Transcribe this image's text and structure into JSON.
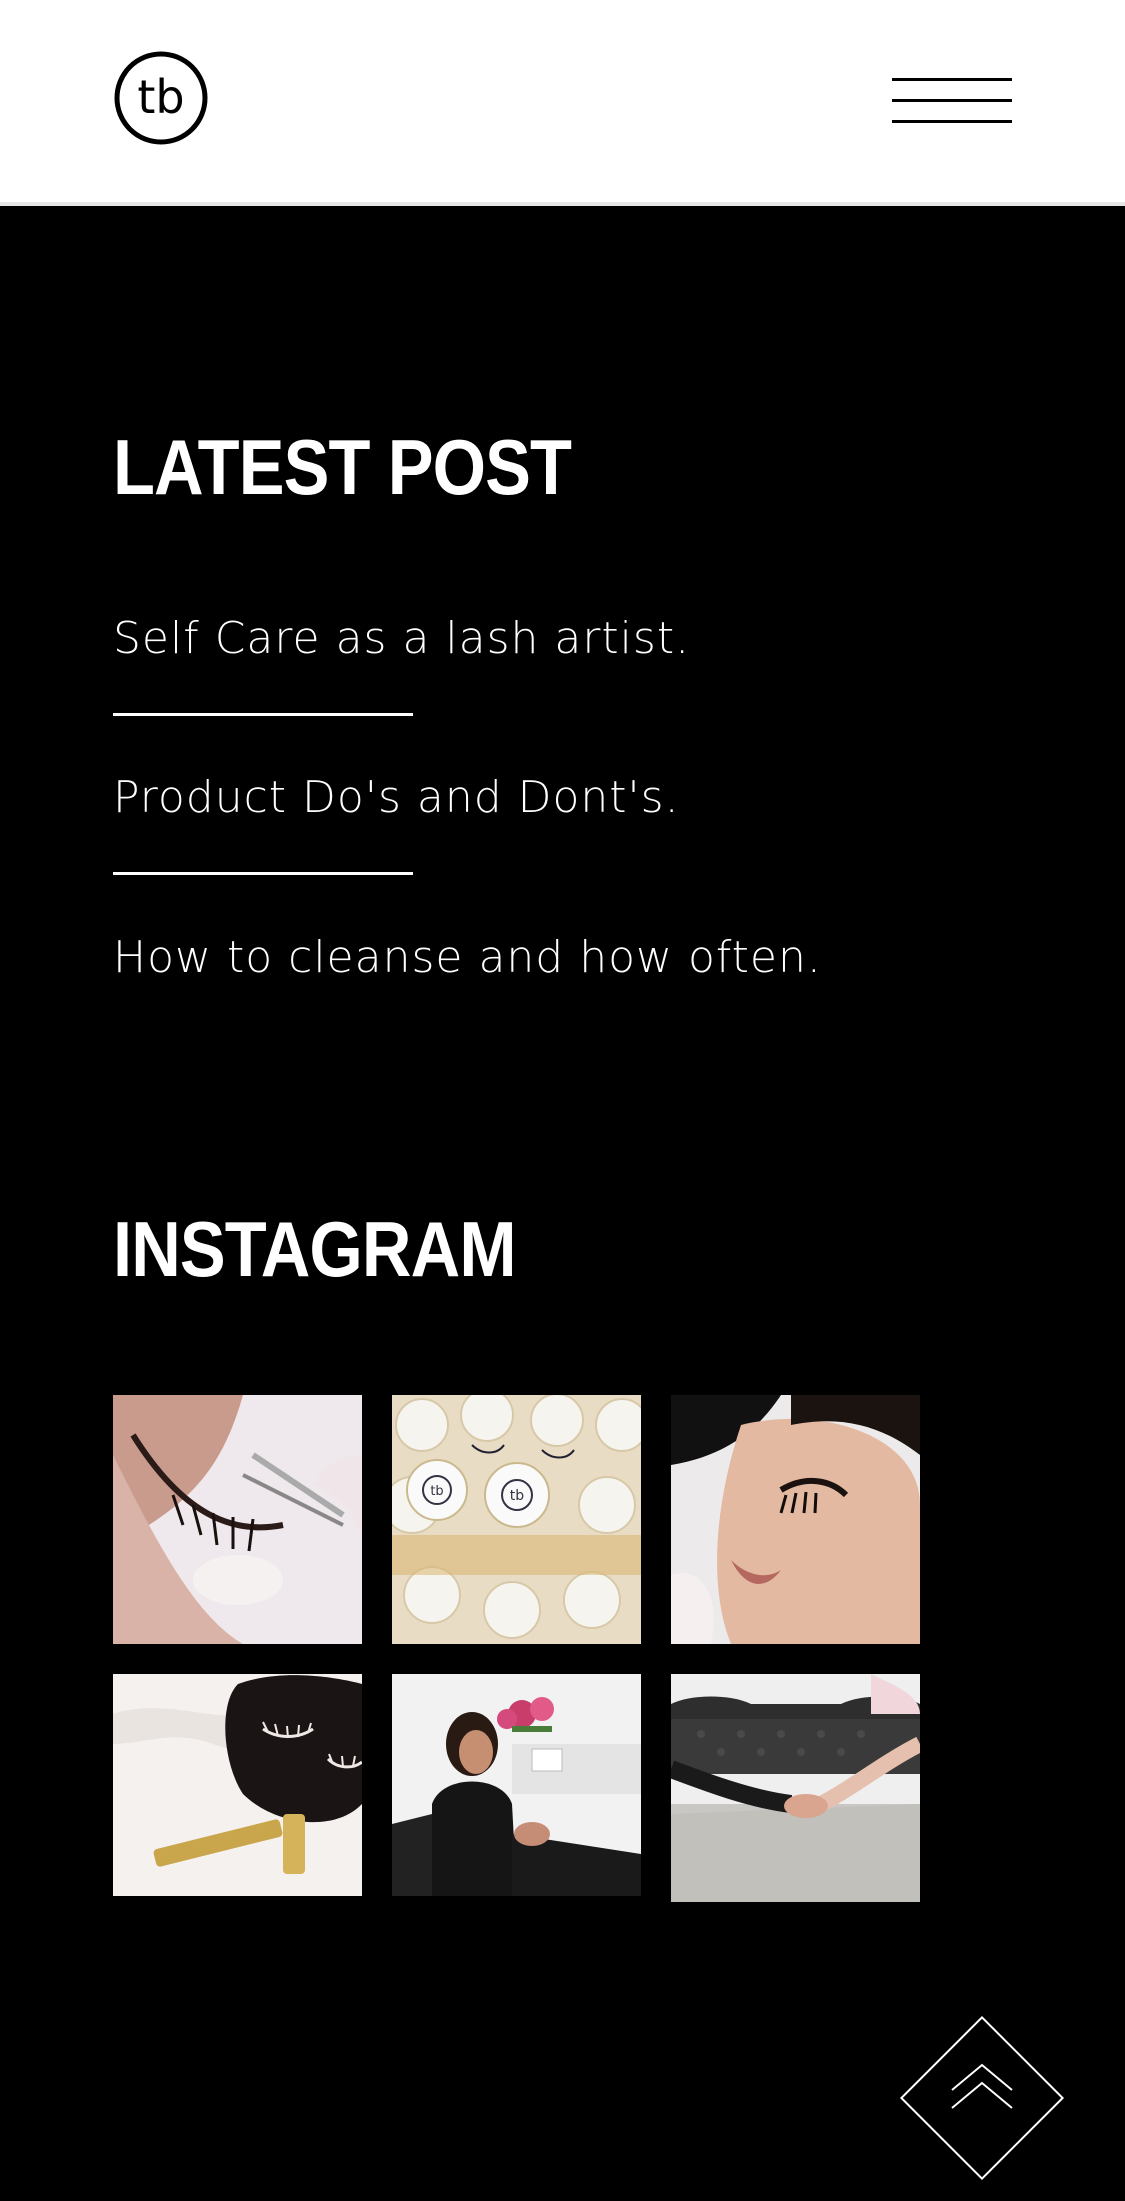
{
  "header": {
    "logo_text": "tb",
    "menu_icon": "hamburger-icon"
  },
  "latest_post": {
    "title": "LATEST POST",
    "posts": [
      {
        "label": "Self Care as a lash artist."
      },
      {
        "label": "Product Do's and Dont's."
      },
      {
        "label": "How to cleanse and how often."
      }
    ]
  },
  "instagram": {
    "title": "INSTAGRAM",
    "cupcake_logo": "tb"
  },
  "footer": {
    "scroll_top_icon": "chevron-up-icon"
  },
  "colors": {
    "background": "#000000",
    "header_background": "#ffffff",
    "text": "#ffffff"
  }
}
